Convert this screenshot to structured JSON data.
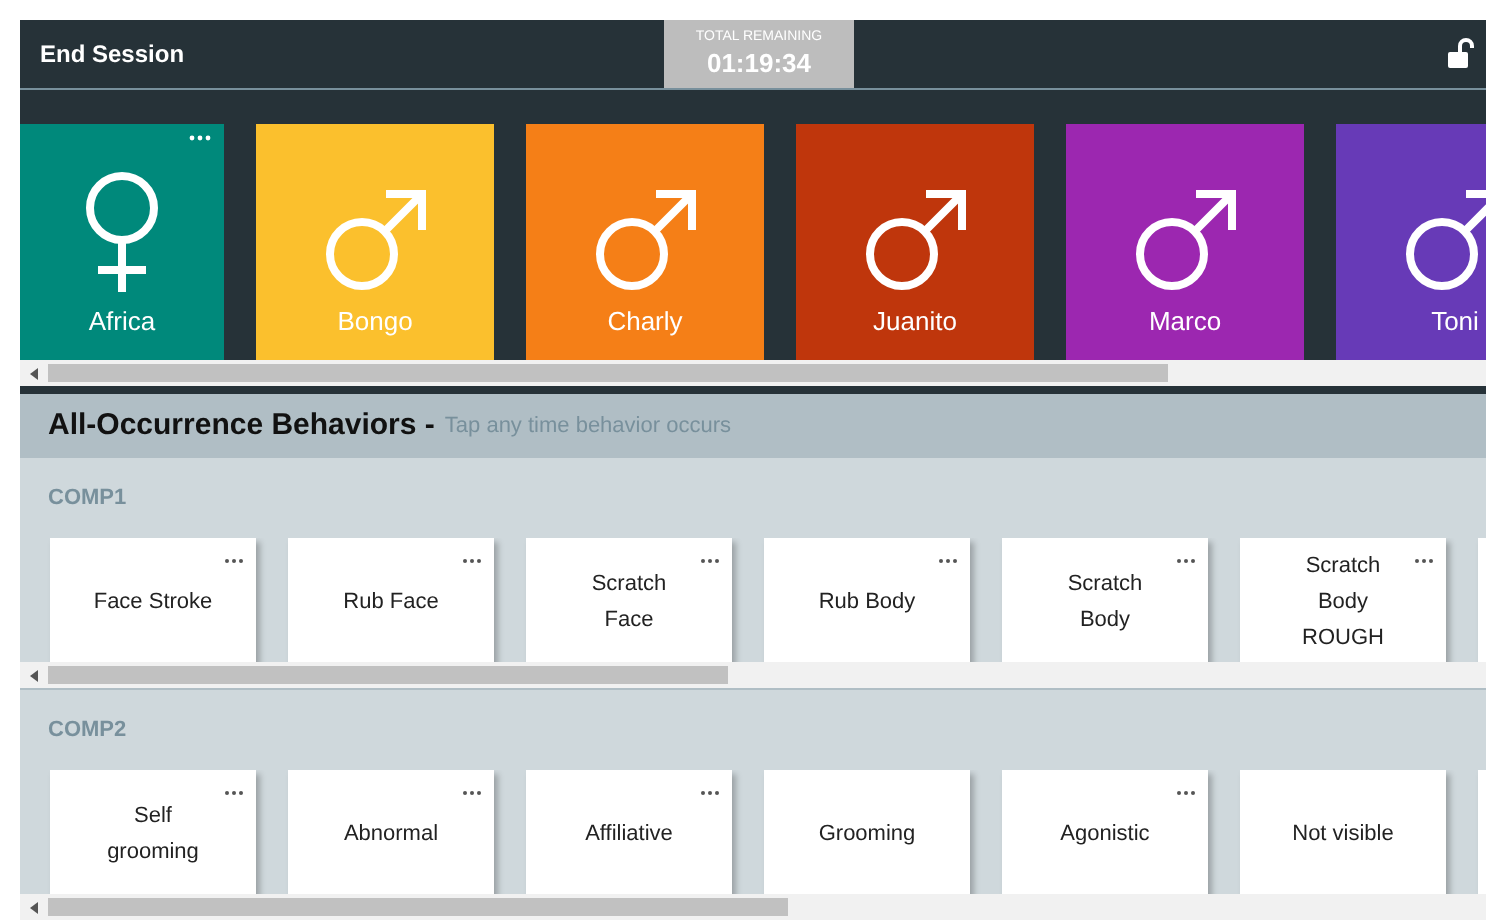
{
  "top_bar": {
    "end_button": "End Session",
    "timer": {
      "label": "TOTAL REMAINING",
      "value": "01:19:34"
    }
  },
  "animals": [
    {
      "name": "Africa",
      "kind": "female",
      "color": "#00897b",
      "menu": true
    },
    {
      "name": "Bongo",
      "kind": "male",
      "color": "#fbc02d",
      "menu": false
    },
    {
      "name": "Charly",
      "kind": "male",
      "color": "#f57f17",
      "menu": false
    },
    {
      "name": "Juanito",
      "kind": "male",
      "color": "#bf360c",
      "menu": false
    },
    {
      "name": "Marco",
      "kind": "male",
      "color": "#9c27b0",
      "menu": false
    },
    {
      "name": "Toni",
      "kind": "male",
      "color": "#673ab7",
      "menu": false
    }
  ],
  "behaviors_header": {
    "title": "All-Occurrence Behaviors -",
    "hint": "Tap any time behavior occurs"
  },
  "groups": [
    {
      "name": "COMP1",
      "behaviors": [
        {
          "label": "Face Stroke",
          "menu": true
        },
        {
          "label": "Rub Face",
          "menu": true
        },
        {
          "label": "Scratch\nFace",
          "menu": true
        },
        {
          "label": "Rub Body",
          "menu": true
        },
        {
          "label": "Scratch\nBody",
          "menu": true
        },
        {
          "label": "Scratch\nBody\nROUGH",
          "menu": true
        }
      ]
    },
    {
      "name": "COMP2",
      "behaviors": [
        {
          "label": "Self\ngrooming",
          "menu": true
        },
        {
          "label": "Abnormal",
          "menu": true
        },
        {
          "label": "Affiliative",
          "menu": true
        },
        {
          "label": "Grooming",
          "menu": false
        },
        {
          "label": "Agonistic",
          "menu": true
        },
        {
          "label": "Not visible",
          "menu": false
        }
      ]
    }
  ]
}
